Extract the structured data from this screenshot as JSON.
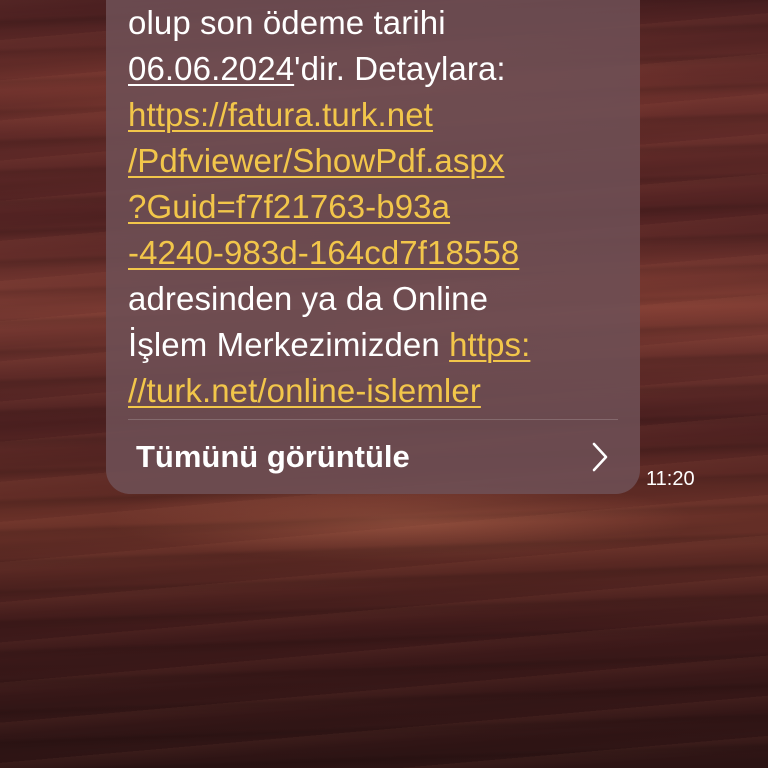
{
  "message": {
    "line1_text": "olup son ödeme tarihi",
    "line2_date": "06.06.2024",
    "line2_rest": "'dir. Detaylara:",
    "link1_parts": [
      "https://fatura.turk.net",
      "/Pdfviewer/ShowPdf.aspx",
      "?Guid=f7f21763-b93a",
      "-4240-983d-164cd7f18558"
    ],
    "line7_text": "adresinden ya da Online",
    "line8_text": "İşlem Merkezimizden ",
    "link2_part1": "https:",
    "link2_part2": "//turk.net/online-islemler"
  },
  "footer": {
    "view_all_label": "Tümünü görüntüle",
    "chevron_icon": "chevron-right-icon"
  },
  "timestamp": "11:20",
  "colors": {
    "bubble": "#6e5055",
    "link": "#f2c64a",
    "text": "#ffffff"
  }
}
